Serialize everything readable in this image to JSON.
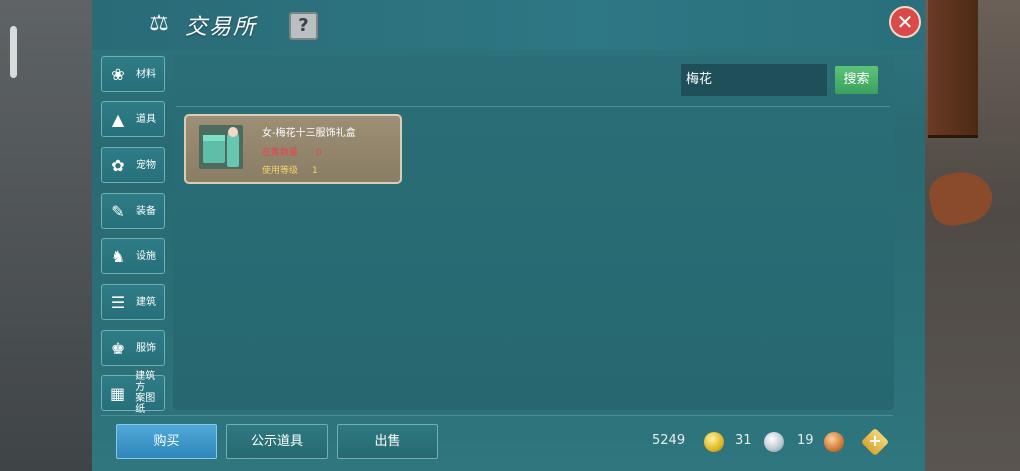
{
  "window": {
    "title": "交易所",
    "help_label": "?",
    "close_label": "✕"
  },
  "categories": [
    {
      "label": "材料",
      "icon": "materials-icon"
    },
    {
      "label": "道具",
      "icon": "item-icon"
    },
    {
      "label": "宠物",
      "icon": "paw-icon"
    },
    {
      "label": "装备",
      "icon": "equipment-icon"
    },
    {
      "label": "设施",
      "icon": "facility-icon"
    },
    {
      "label": "建筑",
      "icon": "building-icon"
    },
    {
      "label": "服饰",
      "icon": "clothing-icon"
    },
    {
      "label": "建筑方\n案图纸",
      "icon": "blueprint-icon"
    }
  ],
  "search": {
    "value": "梅花",
    "button_label": "搜索"
  },
  "results": [
    {
      "name": "女-梅花十三服饰礼盒",
      "on_sale_label": "在售数量",
      "on_sale_value": "0",
      "level_label": "使用等级",
      "level_value": "1"
    }
  ],
  "bottom": {
    "buy_label": "购买",
    "public_label": "公示道具",
    "sell_label": "出售"
  },
  "currency": {
    "gold": "5249",
    "silver": "31",
    "copper": "19"
  },
  "colors": {
    "panel": "#2c6f77",
    "on_sale": "#e8434d",
    "level": "#f3d565",
    "search_button": "#3aa15c",
    "active_tab": "#2f86bb"
  }
}
